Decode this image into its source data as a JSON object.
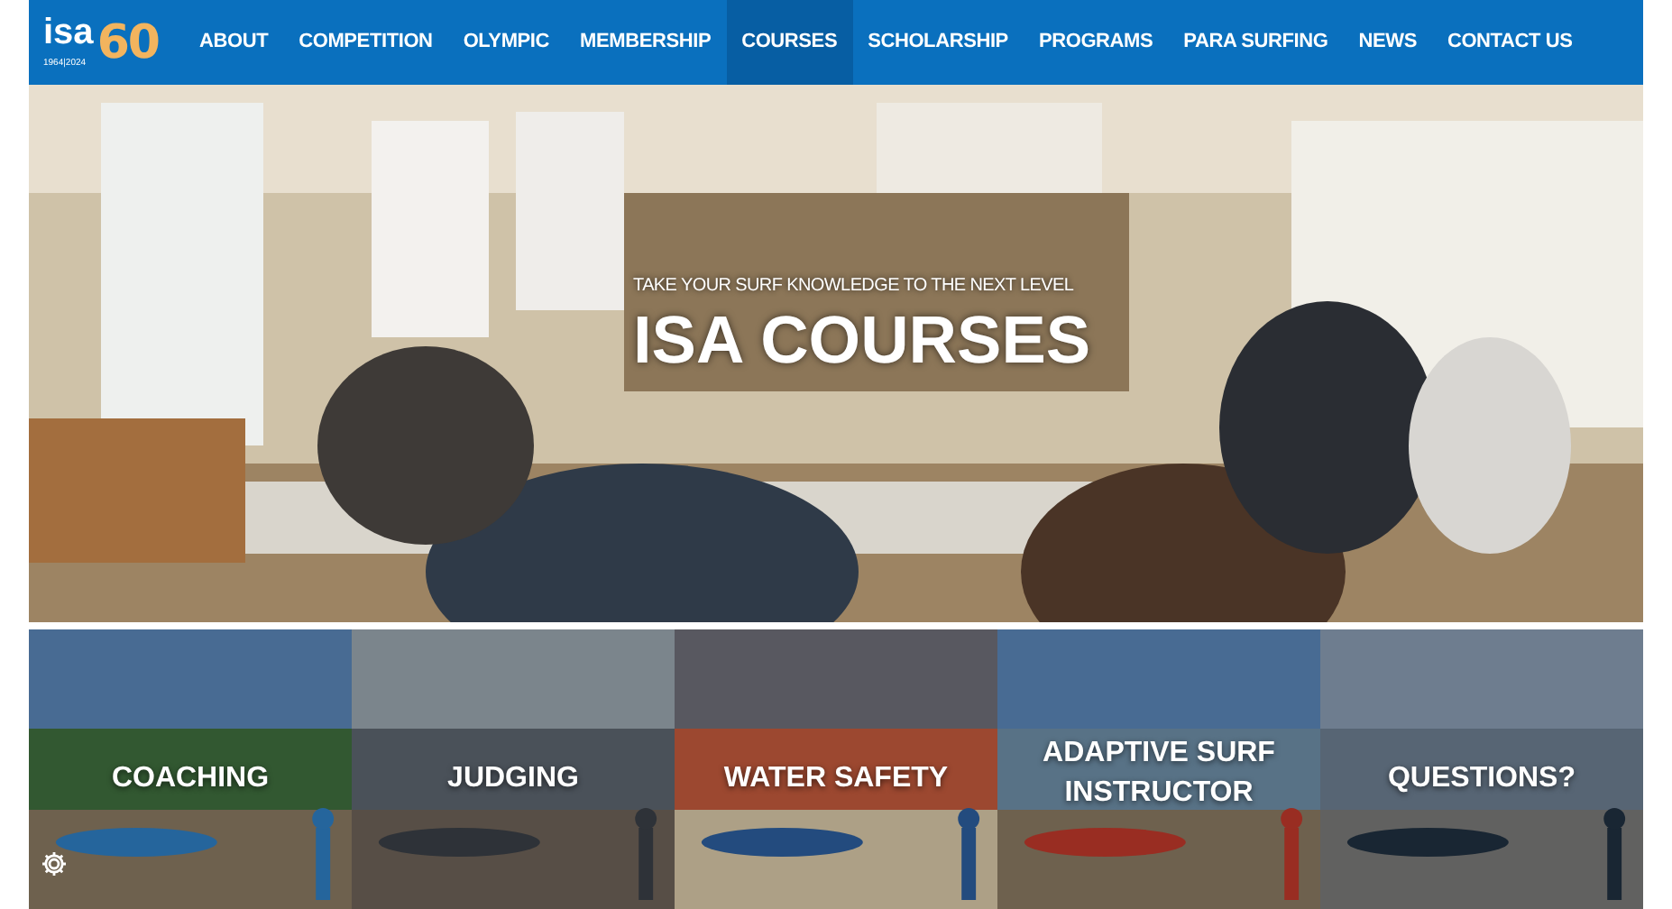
{
  "logo": {
    "word": "isa",
    "number": "60",
    "years": "1964|2024"
  },
  "nav": [
    {
      "label": "ABOUT",
      "selected": false
    },
    {
      "label": "COMPETITION",
      "selected": false
    },
    {
      "label": "OLYMPIC",
      "selected": false
    },
    {
      "label": "MEMBERSHIP",
      "selected": false
    },
    {
      "label": "COURSES",
      "selected": true
    },
    {
      "label": "SCHOLARSHIP",
      "selected": false
    },
    {
      "label": "PROGRAMS",
      "selected": false
    },
    {
      "label": "PARA SURFING",
      "selected": false
    },
    {
      "label": "NEWS",
      "selected": false
    },
    {
      "label": "CONTACT US",
      "selected": false
    }
  ],
  "hero": {
    "kicker": "TAKE YOUR SURF KNOWLEDGE TO THE NEXT LEVEL",
    "title": "ISA COURSES",
    "kind": "picture"
  },
  "tiles": [
    {
      "label": "COACHING",
      "kind": "picture"
    },
    {
      "label": "JUDGING",
      "kind": "picture"
    },
    {
      "label": "WATER SAFETY",
      "kind": "picture"
    },
    {
      "label": "ADAPTIVE SURF INSTRUCTOR",
      "kind": "picture"
    },
    {
      "label": "QUESTIONS?",
      "kind": "picture"
    }
  ]
}
